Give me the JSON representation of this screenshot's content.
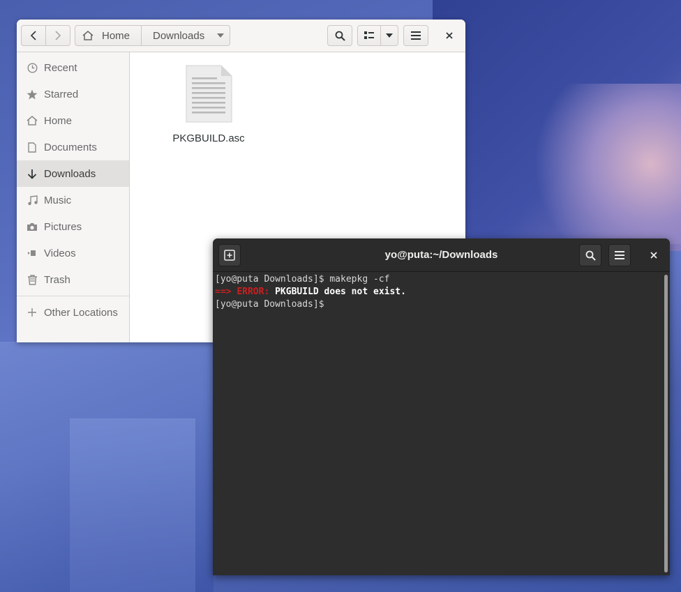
{
  "files_window": {
    "header": {
      "crumb_home": "Home",
      "crumb_downloads": "Downloads"
    },
    "sidebar": {
      "items": [
        {
          "label": "Recent",
          "icon": "clock-icon"
        },
        {
          "label": "Starred",
          "icon": "star-icon"
        },
        {
          "label": "Home",
          "icon": "home-icon"
        },
        {
          "label": "Documents",
          "icon": "document-icon"
        },
        {
          "label": "Downloads",
          "icon": "download-icon",
          "active": true
        },
        {
          "label": "Music",
          "icon": "music-icon"
        },
        {
          "label": "Pictures",
          "icon": "camera-icon"
        },
        {
          "label": "Videos",
          "icon": "video-icon"
        },
        {
          "label": "Trash",
          "icon": "trash-icon"
        }
      ],
      "other_locations": "Other Locations"
    },
    "files": [
      {
        "name": "PKGBUILD.asc",
        "icon": "text-file-icon"
      }
    ]
  },
  "terminal": {
    "title": "yo@puta:~/Downloads",
    "lines": {
      "line1": "[yo@puta Downloads]$ makepkg -cf",
      "arrow": "==>",
      "error_label": "ERROR:",
      "error_msg": "PKGBUILD does not exist.",
      "line3": "[yo@puta Downloads]$ "
    }
  }
}
